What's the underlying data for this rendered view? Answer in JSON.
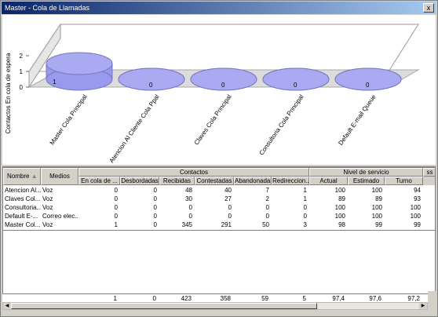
{
  "window": {
    "title": "Master - Cola de Llamadas",
    "close_label": "x"
  },
  "chart_data": {
    "type": "bar",
    "ylabel": "Contactos En cola de espera",
    "yticks": [
      "0",
      "1",
      "2"
    ],
    "ylim": [
      0,
      2
    ],
    "categories": [
      "Master Cola Principal",
      "Atencion Al Cliente Cola Ppal",
      "Claves Cola Principal",
      "Consultoria Cola Principal",
      "Default E-mail Queue"
    ],
    "values": [
      1,
      0,
      0,
      0,
      0
    ],
    "value_labels": [
      "1",
      "0",
      "0",
      "0",
      "0"
    ],
    "bar_color": "#9999ee"
  },
  "grid": {
    "group_contactos": "Contactos",
    "group_servicio": "Nivel de servicio",
    "group_extra": "ss",
    "col_nombre": "Nombre",
    "col_medios": "Medios",
    "columns": [
      "En cola de ...",
      "Desbordadas",
      "Recibidas",
      "Contestadas",
      "Abandonadas",
      "Redireccion...",
      "Actual",
      "Estimado",
      "Turno"
    ],
    "rows": [
      {
        "nombre": "Atencion Al...",
        "medios": "Voz",
        "vals": [
          "0",
          "0",
          "48",
          "40",
          "7",
          "1",
          "100",
          "100",
          "94"
        ]
      },
      {
        "nombre": "Claves Col...",
        "medios": "Voz",
        "vals": [
          "0",
          "0",
          "30",
          "27",
          "2",
          "1",
          "89",
          "89",
          "93"
        ]
      },
      {
        "nombre": "Consultoria...",
        "medios": "Voz",
        "vals": [
          "0",
          "0",
          "0",
          "0",
          "0",
          "0",
          "100",
          "100",
          "100"
        ]
      },
      {
        "nombre": "Default E-...",
        "medios": "Correo elec...",
        "vals": [
          "0",
          "0",
          "0",
          "0",
          "0",
          "0",
          "100",
          "100",
          "100"
        ]
      },
      {
        "nombre": "Master Col...",
        "medios": "Voz",
        "vals": [
          "1",
          "0",
          "345",
          "291",
          "50",
          "3",
          "98",
          "99",
          "99"
        ]
      }
    ],
    "totals": [
      "1",
      "0",
      "423",
      "358",
      "59",
      "5",
      "97,4",
      "97,6",
      "97,2"
    ]
  }
}
